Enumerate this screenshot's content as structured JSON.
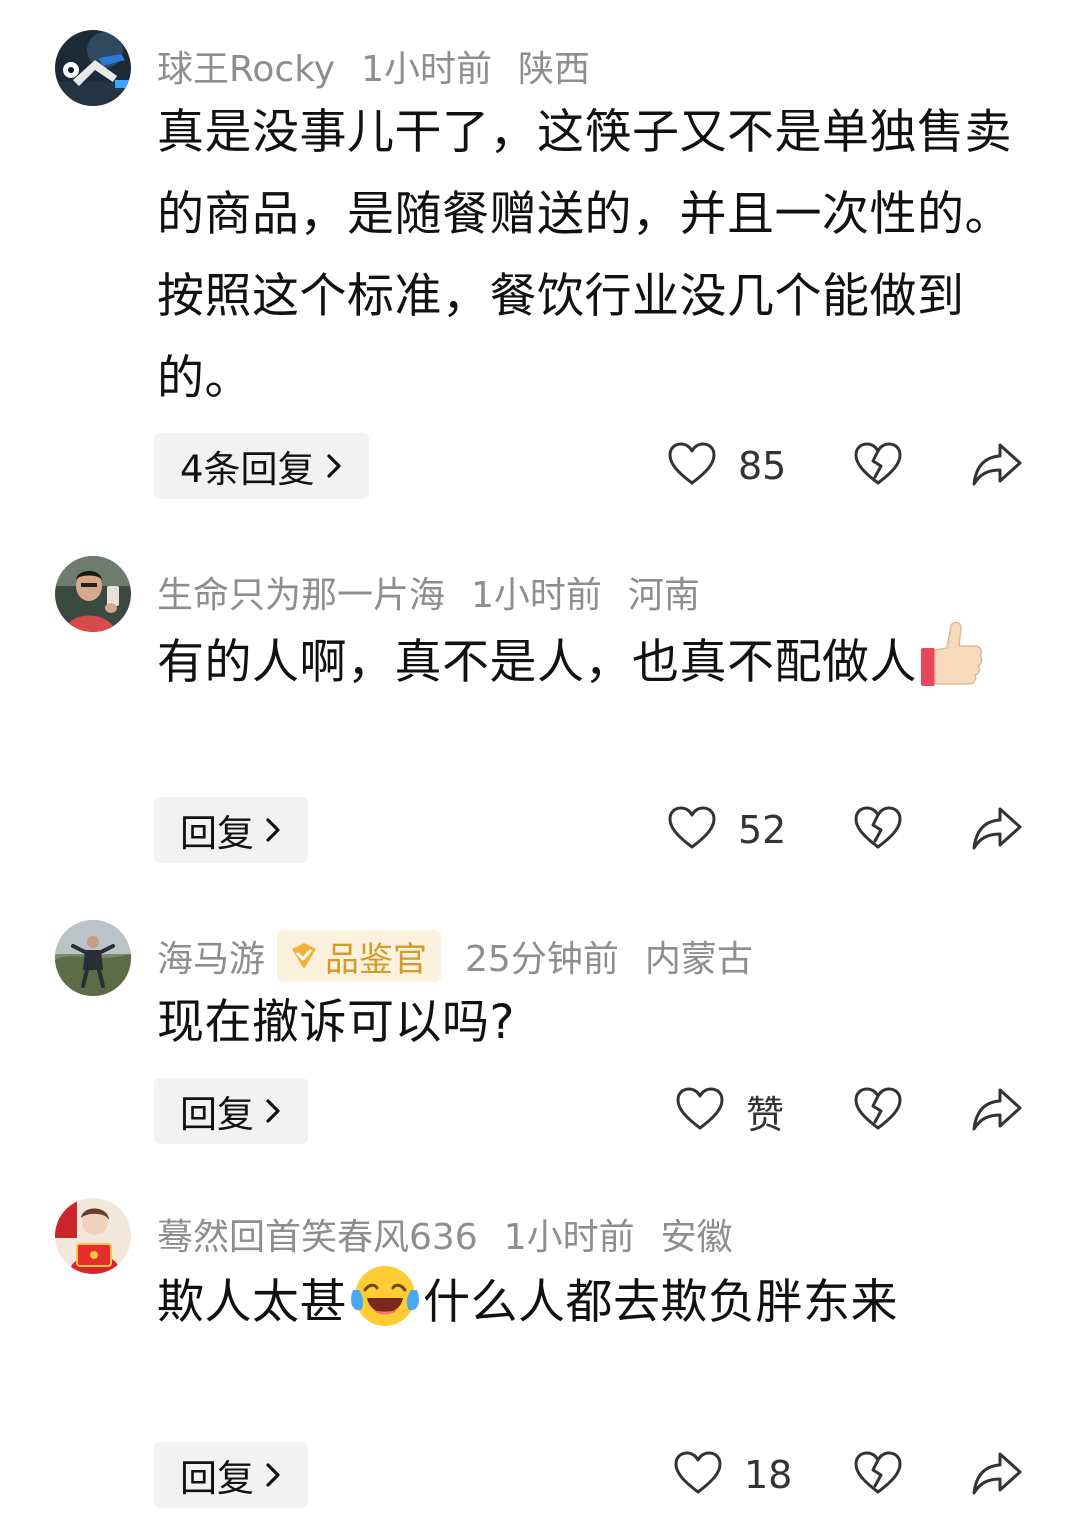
{
  "comments": [
    {
      "username": "球王Rocky",
      "time": "1小时前",
      "location": "陕西",
      "text": "真是没事儿干了，这筷子又不是单独售卖的商品，是随餐赠送的，并且一次性的。按照这个标准，餐饮行业没几个能做到的。",
      "reply_label": "4条回复",
      "like_count": "85",
      "avatar_icon": "soccer-player-avatar"
    },
    {
      "username": "生命只为那一片海",
      "time": "1小时前",
      "location": "河南",
      "text": "有的人啊，真不是人，也真不配做人",
      "emoji_icon": "thumbs-up-emoji",
      "reply_label": "回复",
      "like_count": "52",
      "avatar_icon": "man-selfie-avatar"
    },
    {
      "username": "海马游",
      "badge": "品鉴官",
      "time": "25分钟前",
      "location": "内蒙古",
      "text": "现在撤诉可以吗?",
      "reply_label": "回复",
      "like_count": "赞",
      "avatar_icon": "outdoor-person-avatar"
    },
    {
      "username": "蓦然回首笑春风636",
      "time": "1小时前",
      "location": "安徽",
      "text_before_emoji": "欺人太甚",
      "text_after_emoji": "什么人都去欺负胖东来",
      "emoji_icon": "laughing-crying-emoji",
      "reply_label": "回复",
      "like_count": "18",
      "avatar_icon": "red-envelope-avatar"
    }
  ],
  "colors": {
    "meta_text": "#8e8e8e",
    "body_text": "#111111",
    "reply_bg": "#f2f2f2",
    "badge_bg": "#fbf1dc",
    "badge_text": "#d49a2a",
    "icon_stroke": "#333333"
  }
}
